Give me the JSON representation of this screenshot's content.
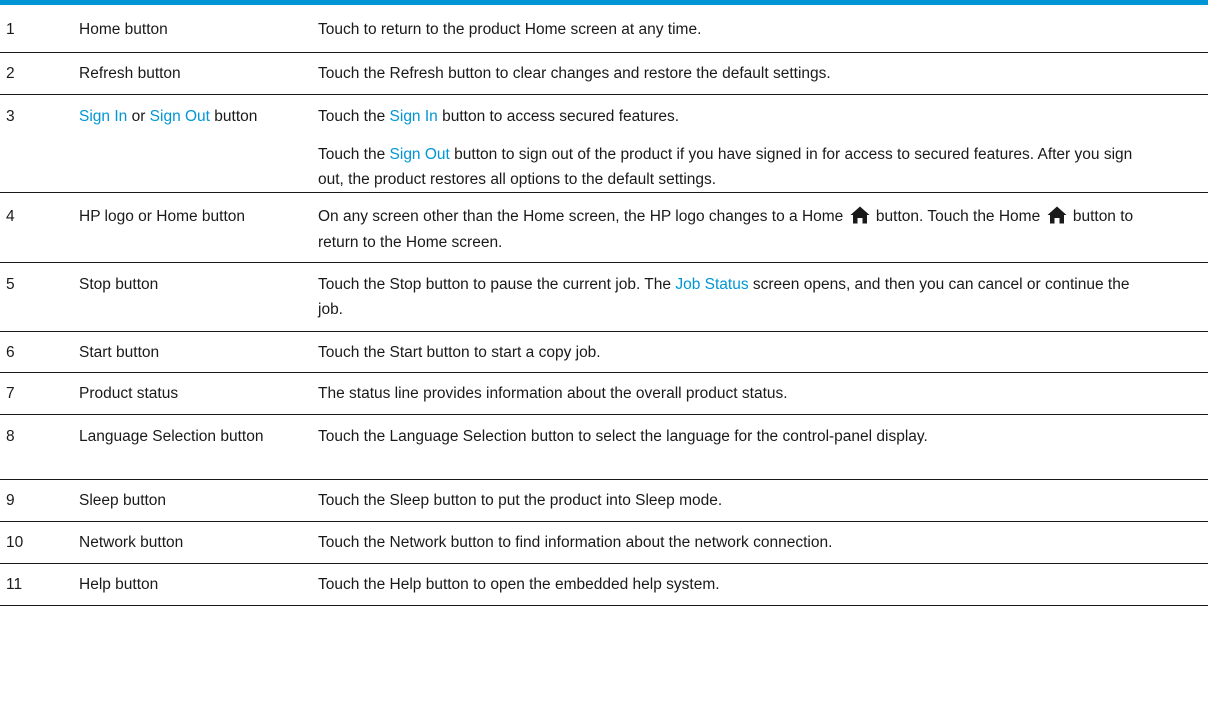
{
  "rows": [
    {
      "num": "1",
      "item": "Home button",
      "desc": "Touch to return to the product Home screen at any time."
    },
    {
      "num": "2",
      "item": "Refresh button",
      "desc": "Touch the Refresh button to clear changes and restore the default settings."
    },
    {
      "num": "3",
      "item_link1": "Sign In",
      "item_mid": " or ",
      "item_link2": "Sign Out",
      "item_end": " button",
      "desc_a_pre": "Touch the ",
      "desc_a_link": "Sign In",
      "desc_a_post": " button to access secured features.",
      "desc_b_pre": "Touch the ",
      "desc_b_link": "Sign Out",
      "desc_b_post": " button to sign out of the product if you have signed in for access to secured features. After you sign out, the product restores all options to the default settings."
    },
    {
      "num": "4",
      "item": "HP logo or Home button",
      "desc_pre": "On any screen other than the Home screen, the HP logo changes to a Home ",
      "desc_mid": " button. Touch the Home ",
      "desc_post": " button to return to the Home screen."
    },
    {
      "num": "5",
      "item": "Stop button",
      "desc_pre": "Touch the Stop button to pause the current job. The ",
      "desc_link": "Job Status",
      "desc_post": " screen opens, and then you can cancel or continue the job."
    },
    {
      "num": "6",
      "item": "Start button",
      "desc": "Touch the Start button to start a copy job."
    },
    {
      "num": "7",
      "item": "Product status",
      "desc": "The status line provides information about the overall product status."
    },
    {
      "num": "8",
      "item": "Language Selection button",
      "desc": "Touch the Language Selection button to select the language for the control-panel display."
    },
    {
      "num": "9",
      "item": "Sleep button",
      "desc": "Touch the Sleep button to put the product into Sleep mode."
    },
    {
      "num": "10",
      "item": "Network button",
      "desc": "Touch the Network button to find information about the network connection."
    },
    {
      "num": "11",
      "item": "Help button",
      "desc": "Touch the Help button to open the embedded help system."
    }
  ],
  "colors": {
    "rule": "#0096d6",
    "link": "#0096d6",
    "text": "#1a1a1a"
  },
  "icons": {
    "home": "home-icon"
  }
}
